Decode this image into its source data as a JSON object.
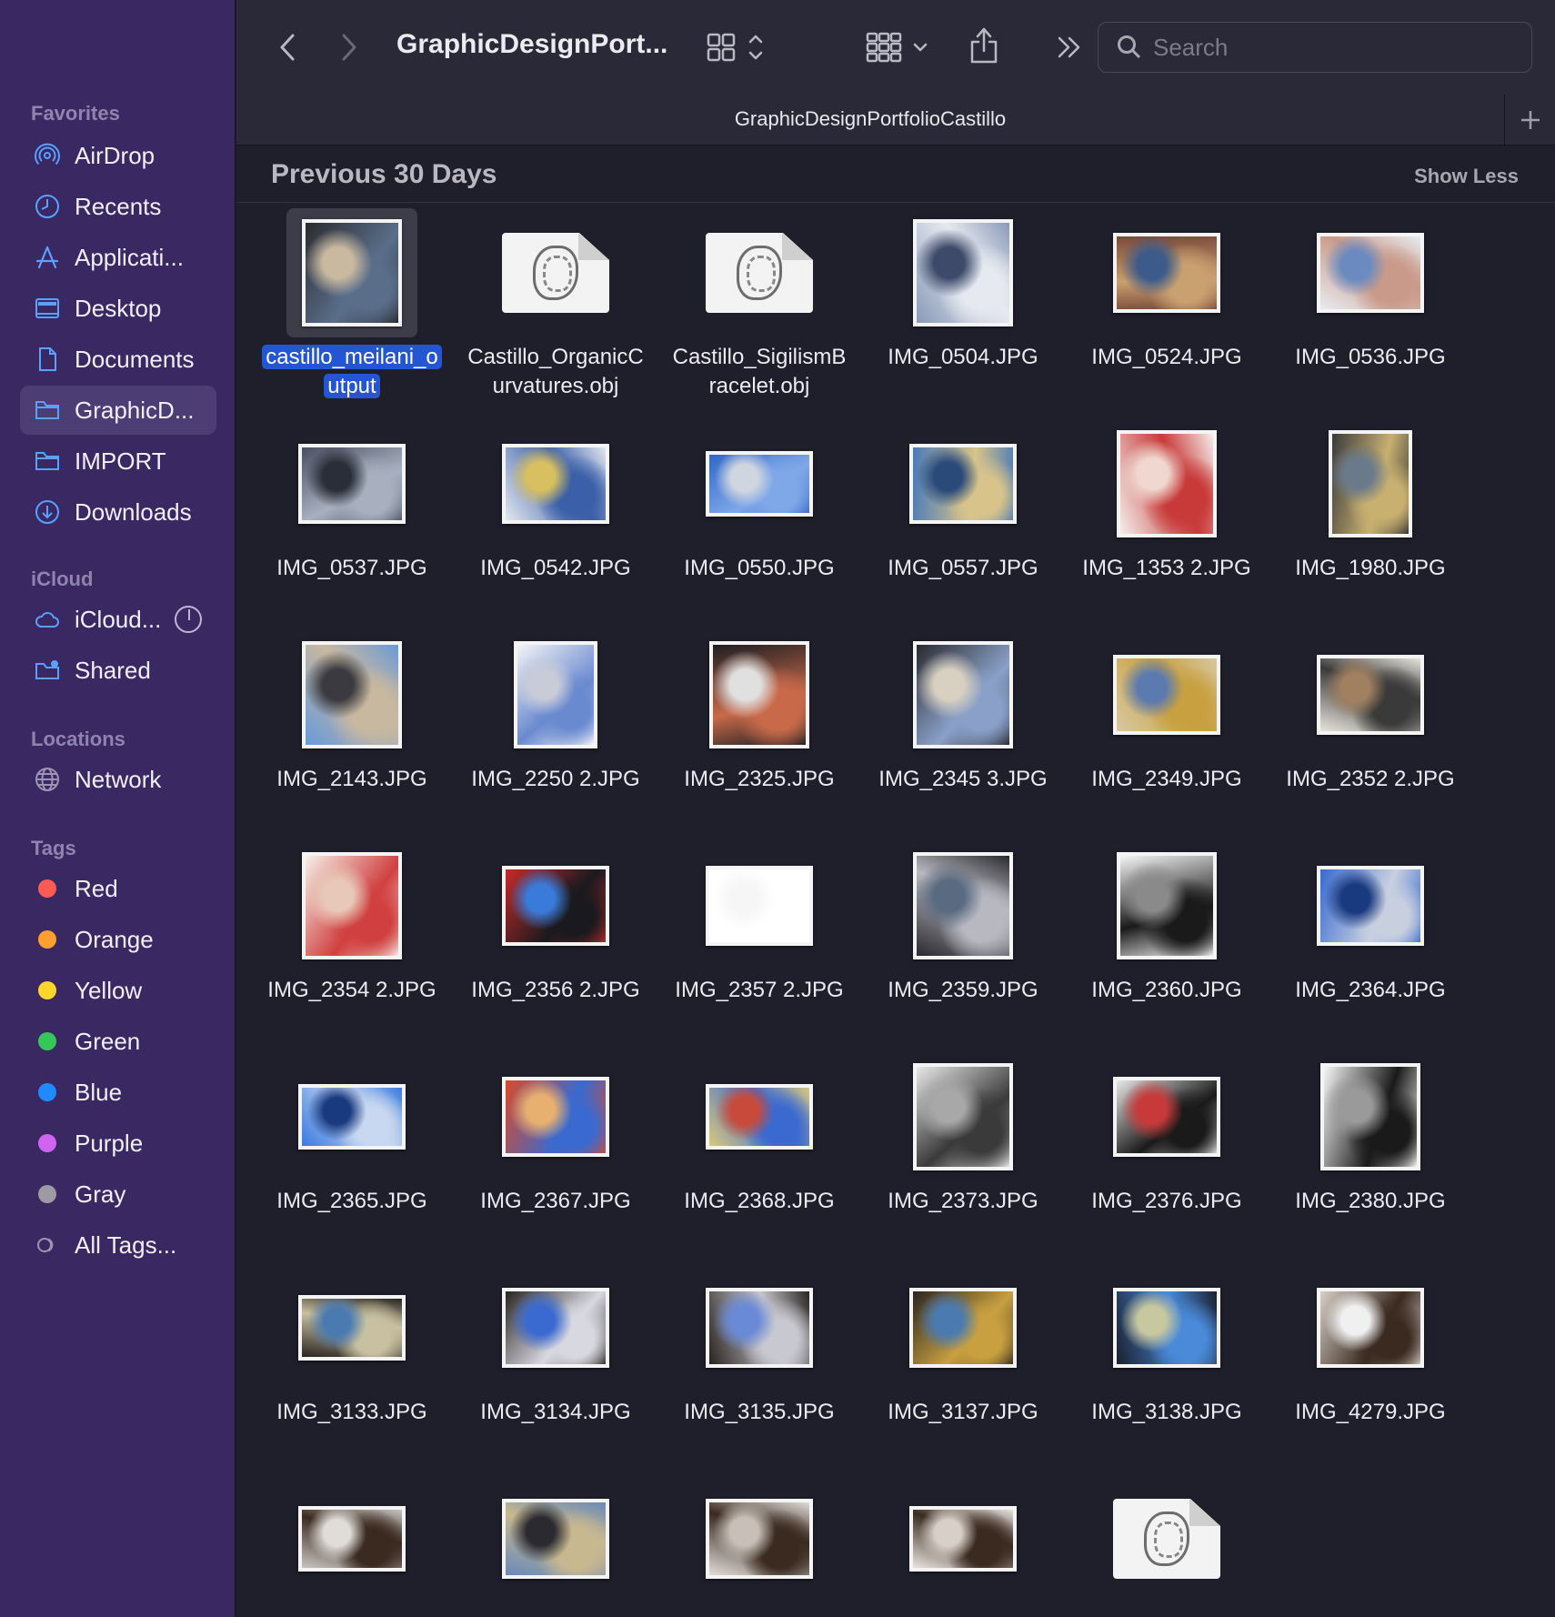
{
  "sidebar": {
    "sections": [
      {
        "heading": "Favorites"
      },
      {
        "heading": "iCloud"
      },
      {
        "heading": "Locations"
      },
      {
        "heading": "Tags"
      }
    ],
    "favorites": [
      {
        "label": "AirDrop",
        "icon": "airdrop-icon"
      },
      {
        "label": "Recents",
        "icon": "clock-icon"
      },
      {
        "label": "Applicati...",
        "icon": "applications-icon"
      },
      {
        "label": "Desktop",
        "icon": "desktop-icon"
      },
      {
        "label": "Documents",
        "icon": "document-icon"
      },
      {
        "label": "GraphicD...",
        "icon": "folder-icon",
        "active": true
      },
      {
        "label": "IMPORT",
        "icon": "folder-icon"
      },
      {
        "label": "Downloads",
        "icon": "download-icon"
      }
    ],
    "icloud": [
      {
        "label": "iCloud...",
        "icon": "cloud-icon"
      },
      {
        "label": "Shared",
        "icon": "shared-folder-icon"
      }
    ],
    "locations": [
      {
        "label": "Network",
        "icon": "globe-icon"
      }
    ],
    "tags": [
      {
        "label": "Red",
        "color": "#ff5b55"
      },
      {
        "label": "Orange",
        "color": "#ff9f2e"
      },
      {
        "label": "Yellow",
        "color": "#ffd52e"
      },
      {
        "label": "Green",
        "color": "#35c759"
      },
      {
        "label": "Blue",
        "color": "#1f8bff"
      },
      {
        "label": "Purple",
        "color": "#d064f0"
      },
      {
        "label": "Gray",
        "color": "#9c9aa3"
      },
      {
        "label": "All Tags...",
        "color": ""
      }
    ]
  },
  "toolbar": {
    "title": "GraphicDesignPort...",
    "search_placeholder": "Search"
  },
  "tab": {
    "title": "GraphicDesignPortfolioCastillo"
  },
  "section": {
    "title": "Previous 30 Days",
    "toggle": "Show Less"
  },
  "files": [
    {
      "name": "castillo_meilani_output",
      "lines": [
        "castillo_meilani_o",
        "utput"
      ],
      "kind": "image",
      "colors": [
        "#2b2b2f",
        "#5a6e8a",
        "#c9b9a0"
      ],
      "portrait": true,
      "selected": true
    },
    {
      "name": "Castillo_OrganicCurvatures.obj",
      "lines": [
        "Castillo_OrganicC",
        "urvatures.obj"
      ],
      "kind": "doc"
    },
    {
      "name": "Castillo_SigilismBracelet.obj",
      "lines": [
        "Castillo_SigilismB",
        "racelet.obj"
      ],
      "kind": "doc"
    },
    {
      "name": "IMG_0504.JPG",
      "kind": "image",
      "colors": [
        "#8a9ab8",
        "#e6e9f0",
        "#3e4a6a"
      ],
      "portrait": true
    },
    {
      "name": "IMG_0524.JPG",
      "kind": "image",
      "colors": [
        "#7a4a3a",
        "#c9a070",
        "#3c5a8a"
      ]
    },
    {
      "name": "IMG_0536.JPG",
      "kind": "image",
      "colors": [
        "#e8ebf0",
        "#c99a8a",
        "#6a8ac0"
      ]
    },
    {
      "name": "IMG_0537.JPG",
      "kind": "image",
      "colors": [
        "#4a5060",
        "#a8b0c0",
        "#2a2e38"
      ]
    },
    {
      "name": "IMG_0542.JPG",
      "kind": "image",
      "colors": [
        "#e3e7ef",
        "#3b5fa8",
        "#d8c060"
      ]
    },
    {
      "name": "IMG_0550.JPG",
      "kind": "image",
      "colors": [
        "#2f66c8",
        "#7fa8e8",
        "#d0d6e0"
      ]
    },
    {
      "name": "IMG_0557.JPG",
      "kind": "image",
      "colors": [
        "#4a7ab8",
        "#d8c48a",
        "#2a4a7a"
      ]
    },
    {
      "name": "IMG_1353 2.JPG",
      "kind": "image",
      "colors": [
        "#f4eeea",
        "#c83a3a",
        "#f0d8d0"
      ],
      "portrait": true
    },
    {
      "name": "IMG_1980.JPG",
      "kind": "image",
      "colors": [
        "#3a3a3a",
        "#c8b070",
        "#6a7a8a"
      ],
      "portrait": true
    },
    {
      "name": "IMG_2143.JPG",
      "kind": "image",
      "colors": [
        "#6a9ad8",
        "#c8b8a0",
        "#3a3a40"
      ],
      "portrait": true
    },
    {
      "name": "IMG_2250 2.JPG",
      "kind": "image",
      "colors": [
        "#f4f4f6",
        "#6a8ad0",
        "#c8ccd8"
      ],
      "portrait": true
    },
    {
      "name": "IMG_2325.JPG",
      "kind": "image",
      "colors": [
        "#1e1e22",
        "#c86a4a",
        "#e0e0e0"
      ],
      "portrait": true
    },
    {
      "name": "IMG_2345 3.JPG",
      "kind": "image",
      "colors": [
        "#2a2a30",
        "#8aa0c8",
        "#d8d0c0"
      ],
      "portrait": true
    },
    {
      "name": "IMG_2349.JPG",
      "kind": "image",
      "colors": [
        "#d8c8a0",
        "#c8a040",
        "#5a7ab0"
      ]
    },
    {
      "name": "IMG_2352 2.JPG",
      "kind": "image",
      "colors": [
        "#e8e4dc",
        "#3a3a3a",
        "#a08060"
      ]
    },
    {
      "name": "IMG_2354 2.JPG",
      "kind": "image",
      "colors": [
        "#f6f0e8",
        "#d04040",
        "#e8c8b8"
      ],
      "portrait": true
    },
    {
      "name": "IMG_2356 2.JPG",
      "kind": "image",
      "colors": [
        "#c82a2a",
        "#1a1a1e",
        "#3a7ad8"
      ]
    },
    {
      "name": "IMG_2357 2.JPG",
      "kind": "image",
      "colors": [
        "#ffffff",
        "#ffffff",
        "#f6f6f6"
      ]
    },
    {
      "name": "IMG_2359.JPG",
      "kind": "image",
      "colors": [
        "#2a2a2e",
        "#b8b8c0",
        "#5a6a80"
      ],
      "portrait": true
    },
    {
      "name": "IMG_2360.JPG",
      "kind": "image",
      "colors": [
        "#f4f4f4",
        "#1a1a1a",
        "#8a8a8a"
      ],
      "portrait": true
    },
    {
      "name": "IMG_2364.JPG",
      "kind": "image",
      "colors": [
        "#3a6ad0",
        "#c8d0e0",
        "#1a3a80"
      ]
    },
    {
      "name": "IMG_2365.JPG",
      "kind": "image",
      "colors": [
        "#3a7ae0",
        "#c8d8f0",
        "#1a3a80"
      ]
    },
    {
      "name": "IMG_2367.JPG",
      "kind": "image",
      "colors": [
        "#d84a2a",
        "#3a6ad0",
        "#e8b070"
      ]
    },
    {
      "name": "IMG_2368.JPG",
      "kind": "image",
      "colors": [
        "#d8c880",
        "#3a6ad0",
        "#c84a3a"
      ]
    },
    {
      "name": "IMG_2373.JPG",
      "kind": "image",
      "colors": [
        "#e8e8e8",
        "#3a3a3a",
        "#a8a8a8"
      ],
      "portrait": true
    },
    {
      "name": "IMG_2376.JPG",
      "kind": "image",
      "colors": [
        "#e8e8e8",
        "#1a1a1a",
        "#c83a3a"
      ]
    },
    {
      "name": "IMG_2380.JPG",
      "kind": "image",
      "colors": [
        "#f6f6f6",
        "#1a1a1a",
        "#9a9a9a"
      ],
      "portrait": true
    },
    {
      "name": "IMG_3133.JPG",
      "kind": "image",
      "colors": [
        "#2a2420",
        "#c8c0a0",
        "#4a7ab0"
      ]
    },
    {
      "name": "IMG_3134.JPG",
      "kind": "image",
      "colors": [
        "#2a2420",
        "#d8d8e0",
        "#3a6ad0"
      ]
    },
    {
      "name": "IMG_3135.JPG",
      "kind": "image",
      "colors": [
        "#2a2420",
        "#c8c8d0",
        "#6a8ad8"
      ]
    },
    {
      "name": "IMG_3137.JPG",
      "kind": "image",
      "colors": [
        "#2a2420",
        "#c8a040",
        "#4a7ab0"
      ]
    },
    {
      "name": "IMG_3138.JPG",
      "kind": "image",
      "colors": [
        "#1a2030",
        "#4a8ad8",
        "#c8c8a0"
      ]
    },
    {
      "name": "IMG_4279.JPG",
      "kind": "image",
      "colors": [
        "#d8d0c8",
        "#3a2a20",
        "#f0f0f0"
      ]
    },
    {
      "name": "",
      "kind": "image",
      "colors": [
        "#c8c4c0",
        "#3a2a20",
        "#e0dcd8"
      ]
    },
    {
      "name": "",
      "kind": "image",
      "colors": [
        "#6a8ab8",
        "#c8b890",
        "#2a2a30"
      ]
    },
    {
      "name": "",
      "kind": "image",
      "colors": [
        "#e0dcd8",
        "#3a2a20",
        "#c8c0b8"
      ]
    },
    {
      "name": "",
      "kind": "image",
      "colors": [
        "#e8e4e0",
        "#3a2a20",
        "#d8d0c8"
      ]
    },
    {
      "name": "",
      "kind": "doc"
    }
  ]
}
